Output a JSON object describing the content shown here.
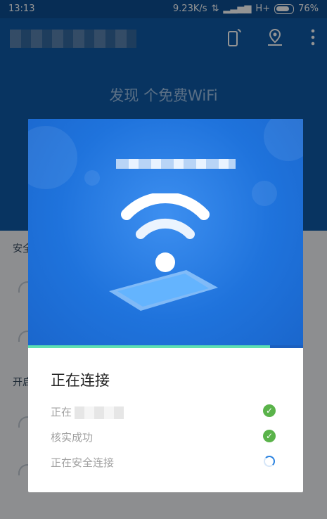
{
  "status_bar": {
    "time": "13:13",
    "speed": "9.23K/s",
    "network": "H+",
    "battery": "76%"
  },
  "app": {
    "found_text": "发现 个免费WiFi",
    "list_section_1": "安全",
    "list_section_2": "开启"
  },
  "dialog": {
    "title": "正在连接",
    "steps": [
      {
        "label": "正在",
        "status": "done"
      },
      {
        "label": "核实成功",
        "status": "done"
      },
      {
        "label": "正在安全连接",
        "status": "loading"
      }
    ],
    "progress": 0.88
  },
  "colors": {
    "primary": "#0e5aa7",
    "hero": "#1f73dc",
    "success": "#5ab34a",
    "progress": "#5fe0b1"
  }
}
